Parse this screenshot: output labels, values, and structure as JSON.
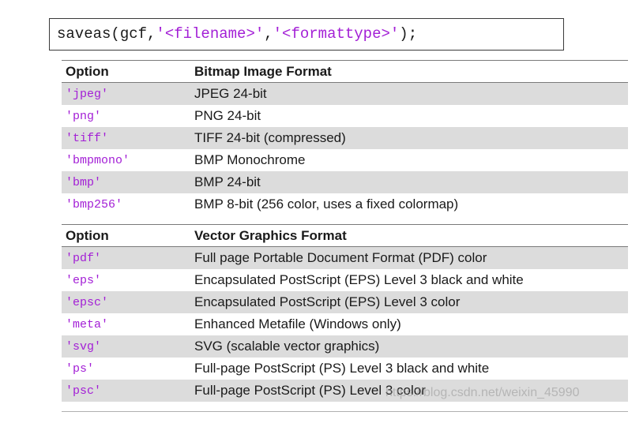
{
  "code": {
    "function": "saveas(gcf,",
    "arg_filename": "'<filename>'",
    "separator": ",",
    "arg_format": "'<formattype>'",
    "closing": ");"
  },
  "bitmap_table": {
    "header_option": "Option",
    "header_format": "Bitmap Image Format",
    "rows": [
      {
        "option": "'jpeg'",
        "format": "JPEG 24-bit"
      },
      {
        "option": "'png'",
        "format": "PNG 24-bit"
      },
      {
        "option": "'tiff'",
        "format": "TIFF 24-bit (compressed)"
      },
      {
        "option": "'bmpmono'",
        "format": "BMP Monochrome"
      },
      {
        "option": "'bmp'",
        "format": "BMP 24-bit"
      },
      {
        "option": "'bmp256'",
        "format": "BMP 8-bit (256 color, uses a fixed colormap)"
      }
    ]
  },
  "vector_table": {
    "header_option": "Option",
    "header_format": "Vector Graphics Format",
    "rows": [
      {
        "option": "'pdf'",
        "format": "Full page Portable Document Format (PDF) color"
      },
      {
        "option": "'eps'",
        "format": "Encapsulated PostScript (EPS) Level 3 black and white"
      },
      {
        "option": "'epsc'",
        "format": "Encapsulated PostScript (EPS) Level 3 color"
      },
      {
        "option": "'meta'",
        "format": "Enhanced Metafile (Windows only)"
      },
      {
        "option": "'svg'",
        "format": "SVG (scalable vector graphics)"
      },
      {
        "option": "'ps'",
        "format": "Full-page PostScript (PS) Level 3 black and white"
      },
      {
        "option": "'psc'",
        "format": "Full-page PostScript (PS) Level 3 color"
      }
    ]
  },
  "watermark": "https://blog.csdn.net/weixin_45990",
  "colors": {
    "string_literal": "#a31fd6",
    "row_shade": "#dcdcdc",
    "text": "#1a1a1a"
  }
}
